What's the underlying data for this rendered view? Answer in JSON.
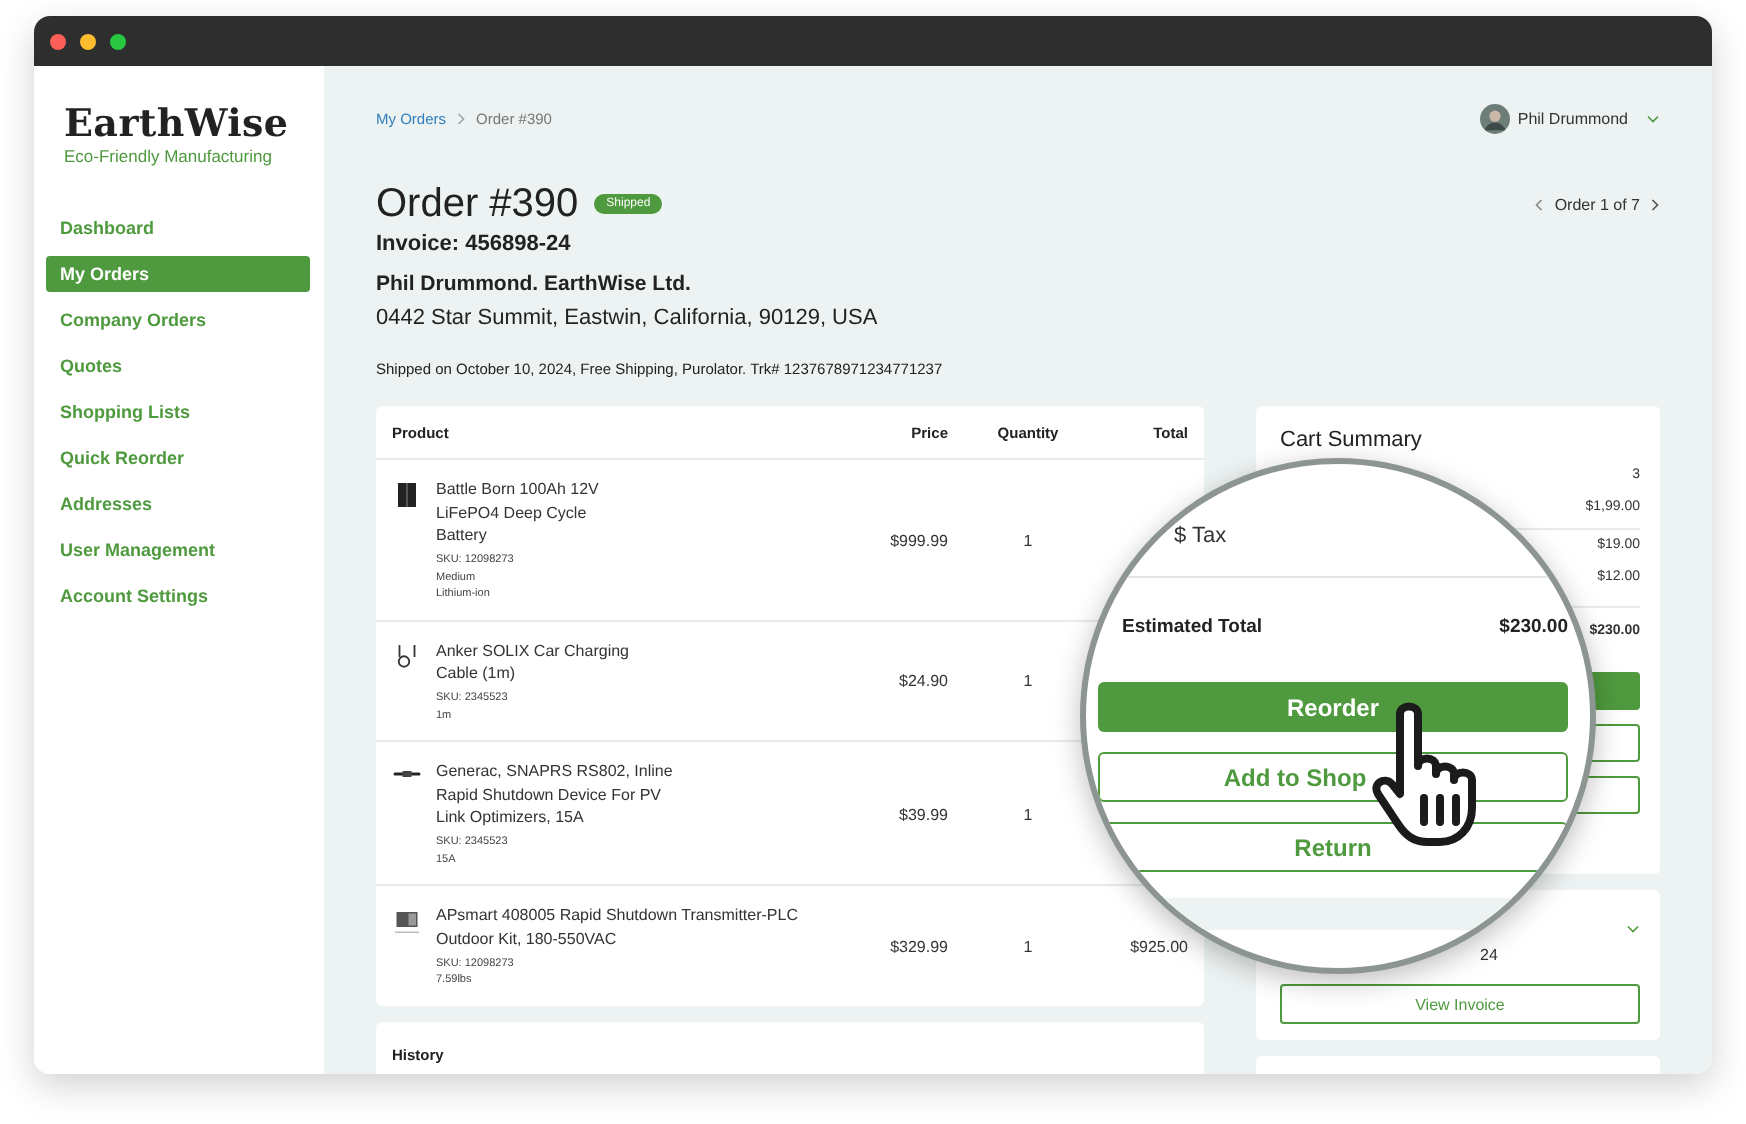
{
  "brand": {
    "name": "EarthWise",
    "tagline": "Eco-Friendly Manufacturing"
  },
  "sidebar": {
    "items": [
      {
        "label": "Dashboard",
        "selected": false
      },
      {
        "label": "My Orders",
        "selected": true
      },
      {
        "label": "Company Orders",
        "selected": false
      },
      {
        "label": "Quotes",
        "selected": false
      },
      {
        "label": "Shopping Lists",
        "selected": false
      },
      {
        "label": "Quick Reorder",
        "selected": false
      },
      {
        "label": "Addresses",
        "selected": false
      },
      {
        "label": "User Management",
        "selected": false
      },
      {
        "label": "Account Settings",
        "selected": false
      }
    ]
  },
  "breadcrumb": [
    {
      "label": "My Orders",
      "kind": "link"
    },
    {
      "label": "Order #390",
      "kind": "current"
    }
  ],
  "user": {
    "name": "Phil Drummond"
  },
  "order": {
    "title": "Order #390",
    "status": "Shipped",
    "invoice": "Invoice: 456898-24",
    "customer": "Phil Drummond. EarthWise Ltd.",
    "address": "0442 Star Summit, Eastwin, California, 90129, USA",
    "shipping": "Shipped on October 10, 2024, Free Shipping, Purolator. Trk# 1237678971234771237"
  },
  "pager": {
    "label": "Order 1 of 7"
  },
  "table": {
    "columns": [
      "Product",
      "Price",
      "Quantity",
      "Total"
    ],
    "rows": [
      {
        "name": "Battle Born 100Ah 12V LiFePO4 Deep Cycle Battery",
        "details": [
          "SKU: 12098273",
          "Medium",
          "Lithium-ion"
        ],
        "price": "$999.99",
        "quantity": "1"
      },
      {
        "name": "Anker SOLIX Car Charging Cable (1m)",
        "details": [
          "SKU: 2345523",
          "1m"
        ],
        "price": "$24.90",
        "quantity": "1"
      },
      {
        "name": "Generac, SNAPRS RS802, Inline Rapid Shutdown Device For PV Link Optimizers, 15A",
        "details": [
          "SKU: 2345523",
          "15A"
        ],
        "price": "$39.99",
        "quantity": "1"
      },
      {
        "name": "APsmart 408005 Rapid Shutdown Transmitter-PLC Outdoor Kit, 180-550VAC",
        "details": [
          "SKU: 12098273",
          "7.59lbs"
        ],
        "price": "$329.99",
        "quantity": "1",
        "total": "$925.00"
      }
    ]
  },
  "history": {
    "title": "History"
  },
  "cart_summary": {
    "title": "Cart Summary",
    "values": [
      "3",
      "$1,99.00",
      "$19.00",
      "$12.00",
      "$230.00"
    ]
  },
  "invoice_card": {
    "text": "24",
    "button": "View Invoice"
  },
  "magnifier": {
    "tax_label": "$ Tax",
    "total_label": "Estimated Total",
    "total_value": "$230.00",
    "buttons": [
      {
        "label": "Reorder",
        "kind": "primary"
      },
      {
        "label": "Add to Shop",
        "kind": "outline"
      },
      {
        "label": "Return",
        "kind": "outline"
      }
    ]
  }
}
